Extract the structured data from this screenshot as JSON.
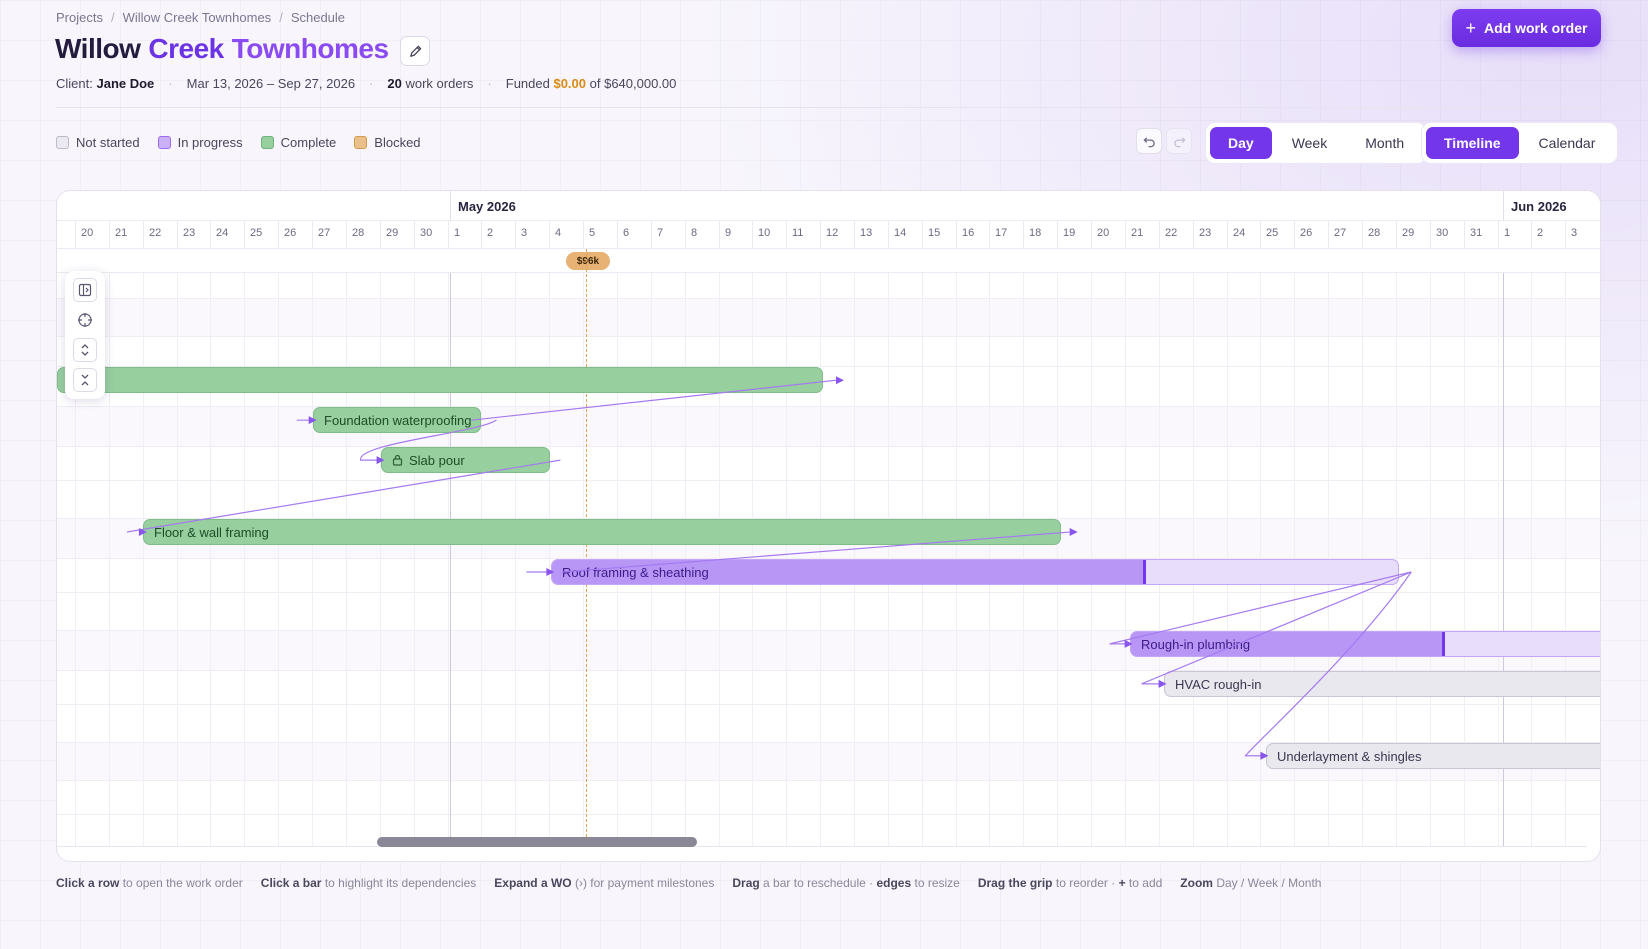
{
  "breadcrumb": [
    "Projects",
    "Willow Creek Townhomes",
    "Schedule"
  ],
  "title": {
    "word1": "Willow",
    "word2": "Creek",
    "word3": "Townhomes"
  },
  "meta": {
    "client_label": "Client:",
    "client_name": "Jane Doe",
    "date_range": "Mar 13, 2026 – Sep 27, 2026",
    "work_orders_count": "20",
    "work_orders_label": "work orders",
    "funded_label": "Funded",
    "funded_amount": "$0.00",
    "funded_of": "of $640,000.00"
  },
  "add_button": "Add work order",
  "legend": [
    {
      "label": "Not started",
      "color": "#ebeaf0",
      "border": "#bdb9c8"
    },
    {
      "label": "In progress",
      "color": "#c9b0f7",
      "border": "#9b6cf0"
    },
    {
      "label": "Complete",
      "color": "#97cf9f",
      "border": "#6fb27b"
    },
    {
      "label": "Blocked",
      "color": "#ecc08a",
      "border": "#d39a52"
    }
  ],
  "zoom_options": [
    "Day",
    "Week",
    "Month"
  ],
  "zoom_active": "Day",
  "view_options": [
    "Timeline",
    "Calendar"
  ],
  "view_active": "Timeline",
  "months": {
    "may": "May 2026",
    "jun": "Jun 2026"
  },
  "days": [
    "20",
    "21",
    "22",
    "23",
    "24",
    "25",
    "26",
    "27",
    "28",
    "29",
    "30",
    "1",
    "2",
    "3",
    "4",
    "5",
    "6",
    "7",
    "8",
    "9",
    "10",
    "11",
    "12",
    "13",
    "14",
    "15",
    "16",
    "17",
    "18",
    "19",
    "20",
    "21",
    "22",
    "23",
    "24",
    "25",
    "26",
    "27",
    "28",
    "29",
    "30",
    "31",
    "1",
    "2",
    "3"
  ],
  "milestone_badge": "$96k",
  "work_orders": [
    {
      "name": "",
      "status": "complete"
    },
    {
      "name": "Foundation waterproofing",
      "status": "complete"
    },
    {
      "name": "Slab pour",
      "status": "complete",
      "locked": true
    },
    {
      "name": "Floor & wall framing",
      "status": "complete"
    },
    {
      "name": "Roof framing & sheathing",
      "status": "progress",
      "progress": 0.64
    },
    {
      "name": "Rough-in plumbing",
      "status": "progress",
      "progress": 0.66
    },
    {
      "name": "HVAC rough-in",
      "status": "notstarted"
    },
    {
      "name": "Underlayment & shingles",
      "status": "notstarted"
    }
  ],
  "hints": [
    {
      "bold": "Click a row",
      "text": "to open the work order"
    },
    {
      "bold": "Click a bar",
      "text": "to highlight its dependencies"
    },
    {
      "bold": "Expand a WO",
      "text": "(›) for payment milestones"
    },
    {
      "bold": "Drag",
      "text": "a bar to reschedule ·"
    },
    {
      "bold": "edges",
      "text": "to resize"
    },
    {
      "bold": "Drag the grip",
      "text": "to reorder ·"
    },
    {
      "bold": "+",
      "text": "to add"
    },
    {
      "bold": "Zoom",
      "text": "Day / Week / Month"
    }
  ]
}
